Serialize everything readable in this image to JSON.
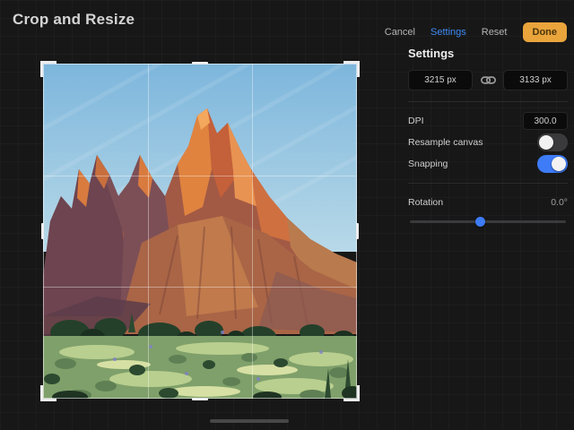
{
  "page": {
    "title": "Crop and Resize"
  },
  "toolbar": {
    "cancel_label": "Cancel",
    "settings_label": "Settings",
    "reset_label": "Reset",
    "done_label": "Done"
  },
  "panel": {
    "heading": "Settings",
    "width_value": "3215 px",
    "height_value": "3133 px",
    "dpi_label": "DPI",
    "dpi_value": "300.0",
    "resample_label": "Resample canvas",
    "resample_on": false,
    "snapping_label": "Snapping",
    "snapping_on": true,
    "rotation_label": "Rotation",
    "rotation_value": "0.0°"
  },
  "icons": {
    "link": "link-icon"
  },
  "colors": {
    "accent_blue": "#3d7bf7",
    "done_button": "#e9a43c",
    "background": "#171717",
    "field_background": "#0b0b0b"
  }
}
